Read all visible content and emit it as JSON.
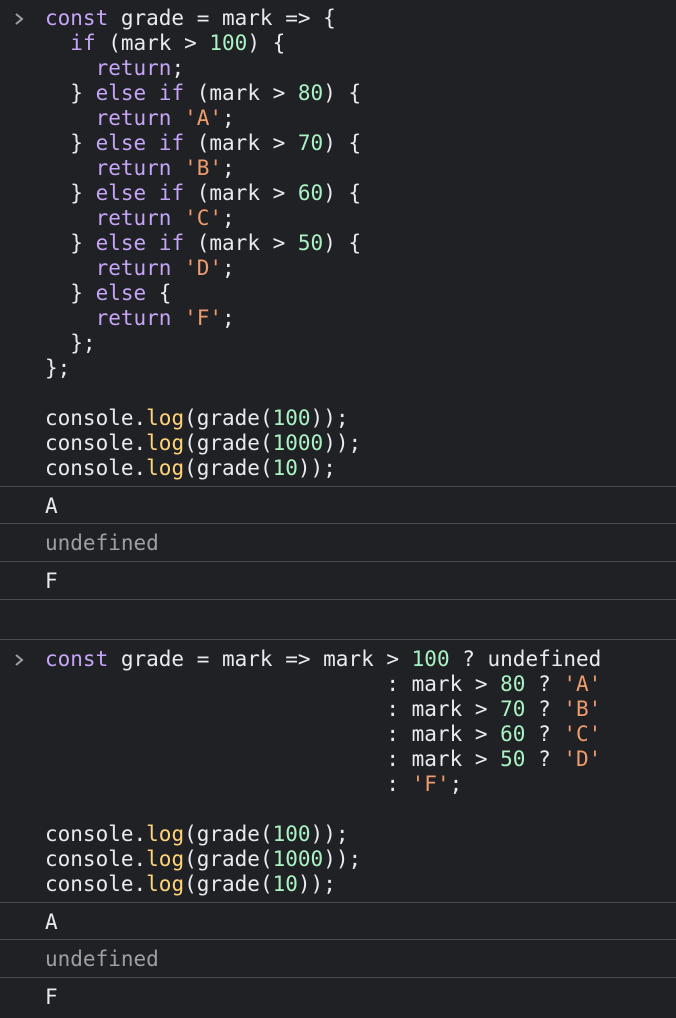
{
  "entries": [
    {
      "code_lines": [
        [
          "const",
          " grade = mark => {"
        ],
        [
          "  if",
          " (mark > ",
          "100",
          ") {"
        ],
        [
          "    return;"
        ],
        [
          "  } ",
          "else if",
          " (mark > ",
          "80",
          ") {"
        ],
        [
          "    return ",
          "'A'",
          ";"
        ],
        [
          "  } ",
          "else if",
          " (mark > ",
          "70",
          ") {"
        ],
        [
          "    return ",
          "'B'",
          ";"
        ],
        [
          "  } ",
          "else if",
          " (mark > ",
          "60",
          ") {"
        ],
        [
          "    return ",
          "'C'",
          ";"
        ],
        [
          "  } ",
          "else if",
          " (mark > ",
          "50",
          ") {"
        ],
        [
          "    return ",
          "'D'",
          ";"
        ],
        [
          "  } ",
          "else",
          " {"
        ],
        [
          "    return ",
          "'F'",
          ";"
        ],
        [
          "  };"
        ],
        [
          "};"
        ],
        [
          ""
        ],
        [
          "console.",
          "log",
          "(grade(",
          "100",
          "));"
        ],
        [
          "console.",
          "log",
          "(grade(",
          "1000",
          "));"
        ],
        [
          "console.",
          "log",
          "(grade(",
          "10",
          "));"
        ]
      ],
      "outputs": [
        "A",
        "undefined",
        "F"
      ]
    },
    {
      "code_lines": [
        [
          "const",
          " grade = mark => mark > ",
          "100",
          " ? undefined"
        ],
        [
          "                           : mark > ",
          "80",
          " ? ",
          "'A'"
        ],
        [
          "                           : mark > ",
          "70",
          " ? ",
          "'B'"
        ],
        [
          "                           : mark > ",
          "60",
          " ? ",
          "'C'"
        ],
        [
          "                           : mark > ",
          "50",
          " ? ",
          "'D'"
        ],
        [
          "                           : ",
          "'F'",
          ";"
        ],
        [
          ""
        ],
        [
          "console.",
          "log",
          "(grade(",
          "100",
          "));"
        ],
        [
          "console.",
          "log",
          "(grade(",
          "1000",
          "));"
        ],
        [
          "console.",
          "log",
          "(grade(",
          "10",
          "));"
        ]
      ],
      "outputs": [
        "A",
        "undefined",
        "F"
      ]
    }
  ],
  "colors": {
    "background": "#202124",
    "text": "#e8eaed",
    "keyword": "#c5a5f7",
    "number": "#a9f2c3",
    "string": "#ee9b6d",
    "function": "#ffd479",
    "muted": "#9aa0a6",
    "divider": "#4a4c50"
  },
  "icons": {
    "prompt": "chevron-right-icon"
  }
}
